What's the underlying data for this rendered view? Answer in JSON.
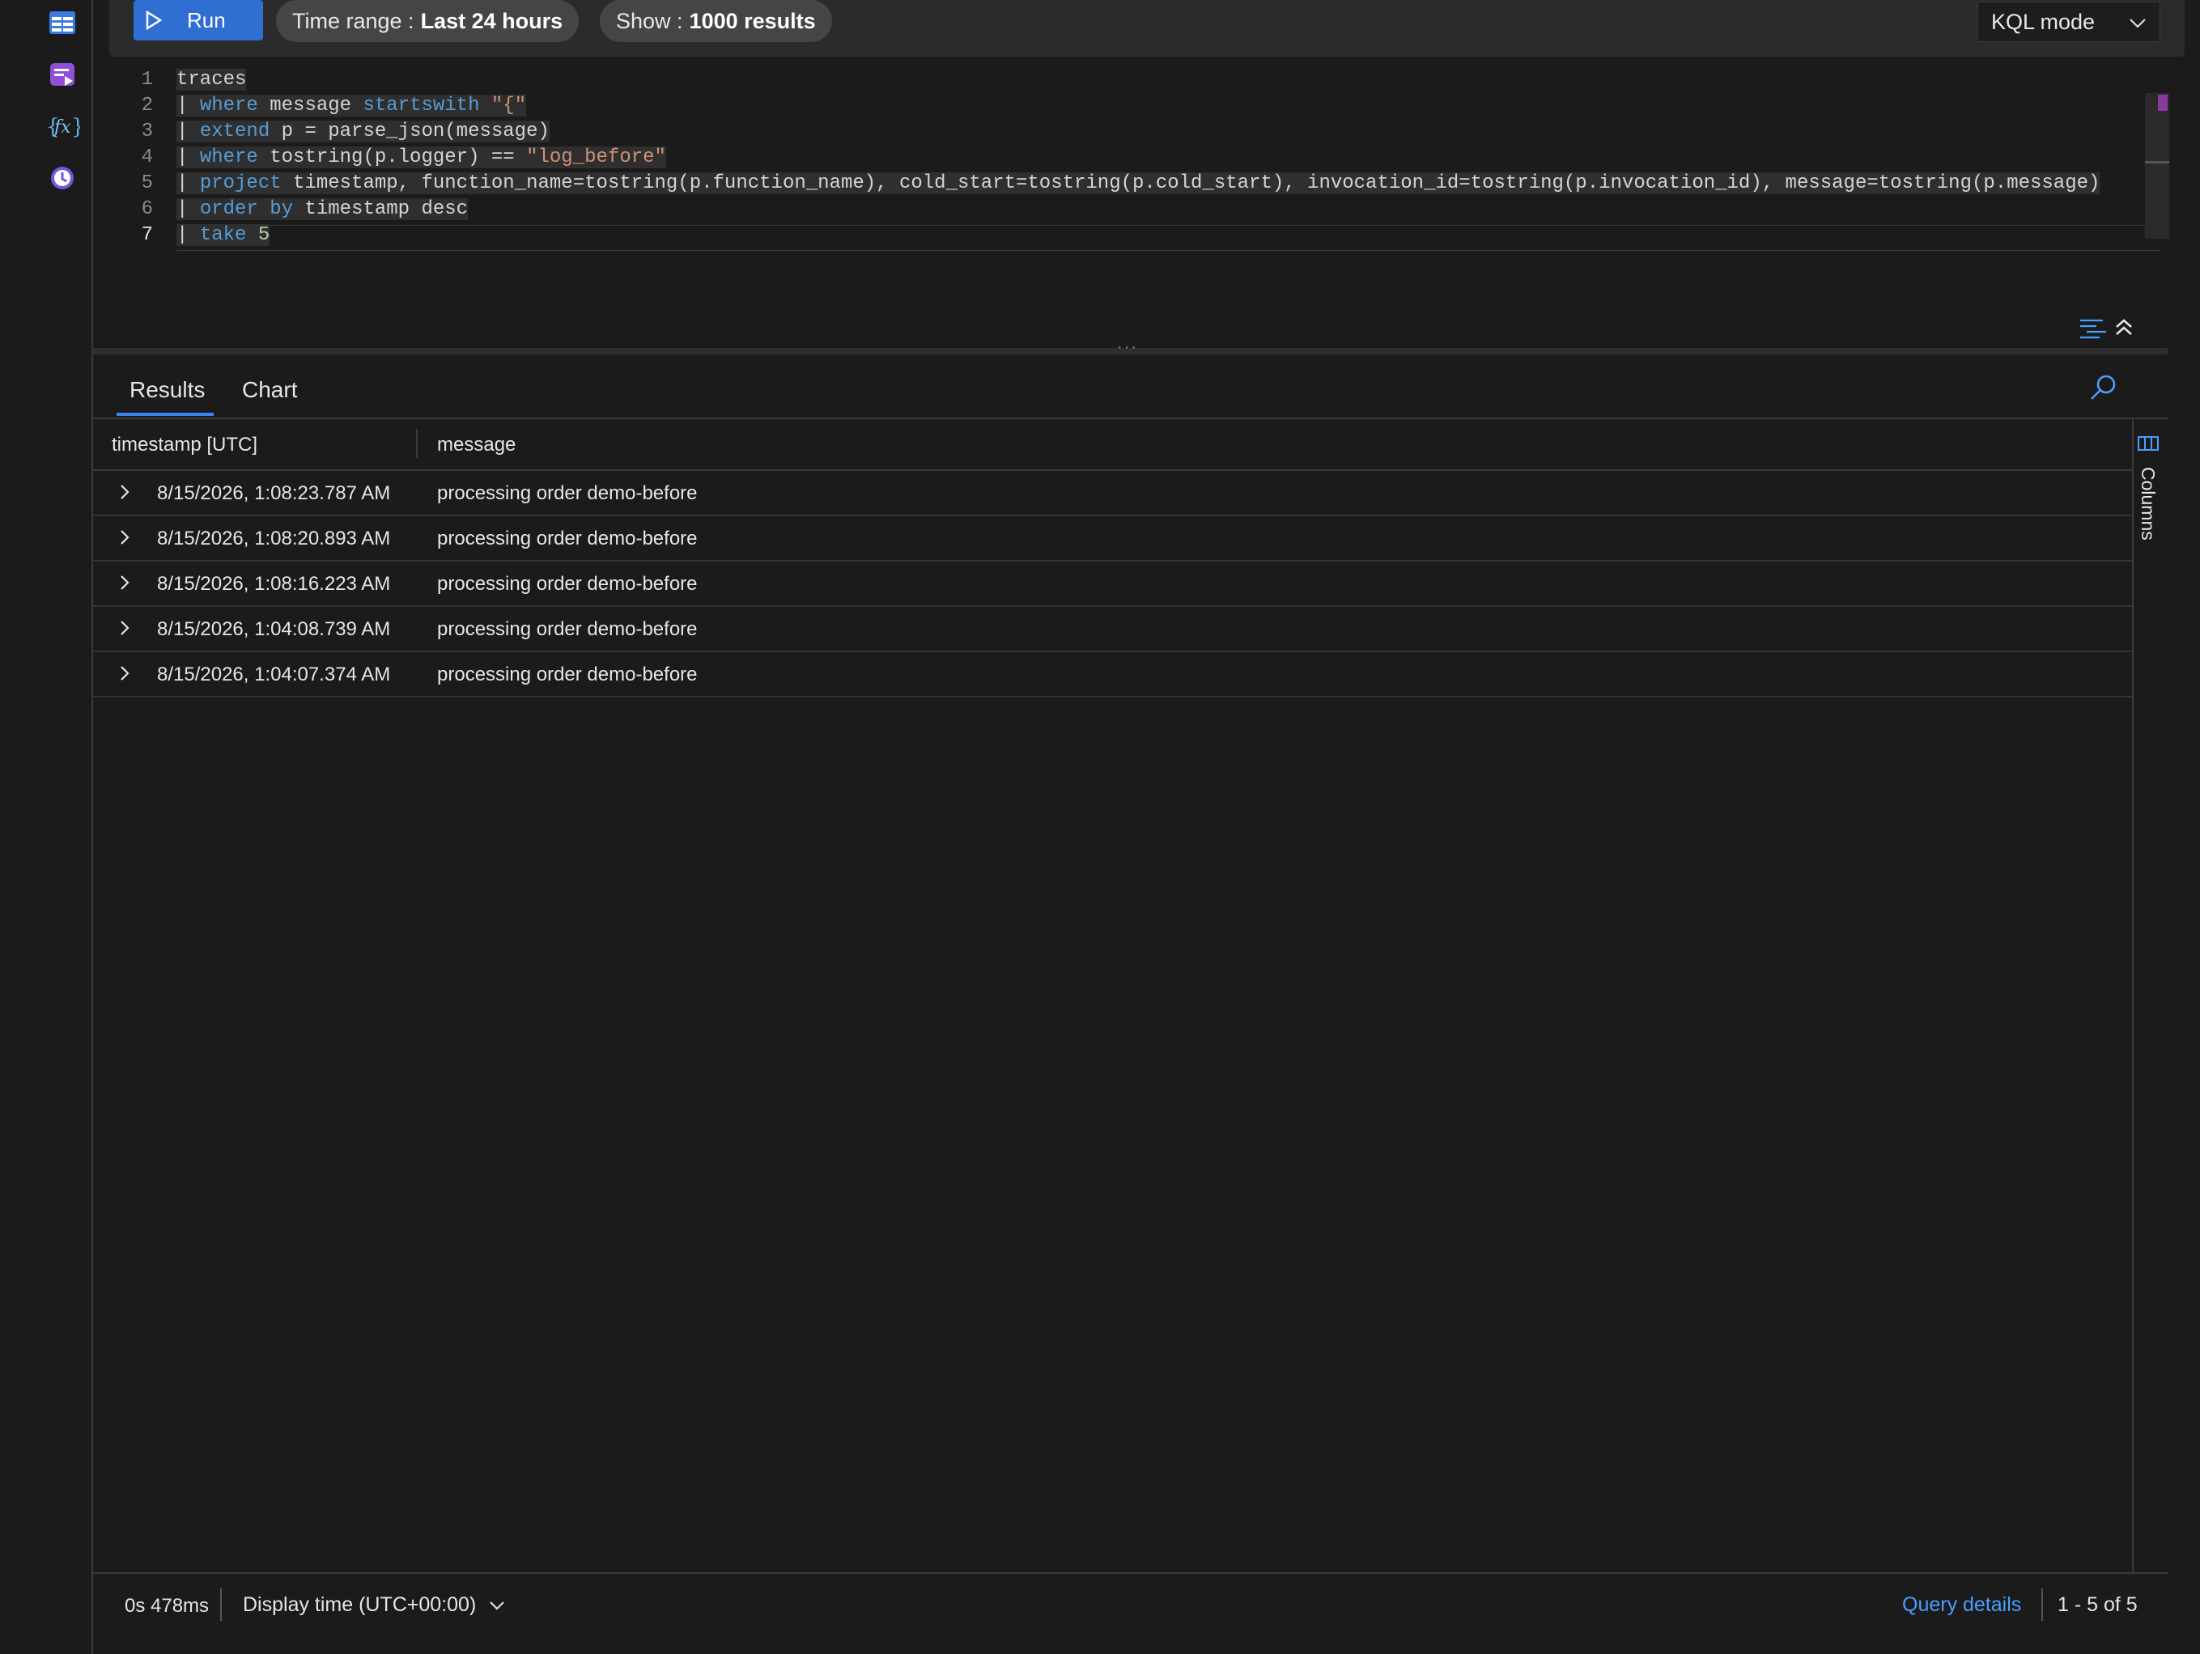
{
  "toolbar": {
    "run_label": "Run",
    "time_range_label": "Time range :",
    "time_range_value": "Last 24 hours",
    "show_label": "Show :",
    "show_value": "1000 results",
    "mode_label": "KQL mode"
  },
  "rail": {
    "icons": [
      "tables-icon",
      "queries-icon",
      "functions-icon",
      "history-icon"
    ]
  },
  "editor": {
    "line_numbers": [
      "1",
      "2",
      "3",
      "4",
      "5",
      "6",
      "7"
    ],
    "active_line": 7,
    "lines": [
      {
        "t1": "traces"
      },
      {
        "p": "| ",
        "k1": "where",
        "t1": " message ",
        "k2": "startswith",
        "t2": " ",
        "s": "\"{\""
      },
      {
        "p": "| ",
        "k1": "extend",
        "t1": " p = parse_json(message)"
      },
      {
        "p": "| ",
        "k1": "where",
        "t1": " tostring(p.logger) == ",
        "s": "\"log_before\""
      },
      {
        "p": "| ",
        "k1": "project",
        "t1": " timestamp, function_name=tostring(p.function_name), cold_start=tostring(p.cold_start), invocation_id=tostring(p.invocation_id), message=tostring(p.message)"
      },
      {
        "p": "| ",
        "k1": "order by",
        "t1": " timestamp desc"
      },
      {
        "p": "| ",
        "k1": "take",
        "t1": " ",
        "n": "5"
      }
    ]
  },
  "results": {
    "tabs": [
      "Results",
      "Chart"
    ],
    "columns": [
      "timestamp [UTC]",
      "message"
    ],
    "rows": [
      {
        "timestamp": "8/15/2026, 1:08:23.787 AM",
        "message": "processing order demo-before"
      },
      {
        "timestamp": "8/15/2026, 1:08:20.893 AM",
        "message": "processing order demo-before"
      },
      {
        "timestamp": "8/15/2026, 1:08:16.223 AM",
        "message": "processing order demo-before"
      },
      {
        "timestamp": "8/15/2026, 1:04:08.739 AM",
        "message": "processing order demo-before"
      },
      {
        "timestamp": "8/15/2026, 1:04:07.374 AM",
        "message": "processing order demo-before"
      }
    ],
    "side_panel_label": "Columns"
  },
  "status": {
    "duration": "0s 478ms",
    "display_time": "Display time (UTC+00:00)",
    "query_details": "Query details",
    "pagination": "1 - 5 of 5"
  },
  "colors": {
    "accent": "#2f6fd1",
    "link": "#4a9eff",
    "background": "#1b1b1b"
  }
}
